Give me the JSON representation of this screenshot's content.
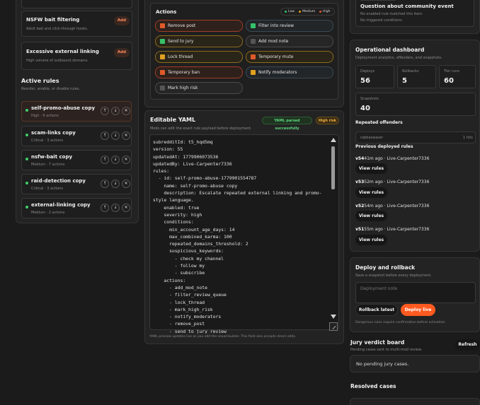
{
  "left_panel": {
    "bait_rule": {
      "title": "NSFW bait filtering",
      "desc": "Adult bait and click-through hooks.",
      "add": "Add"
    },
    "linking_rule": {
      "title": "Excessive external linking",
      "desc": "High volume of outbound domains.",
      "add": "Add"
    },
    "active_rules": {
      "title": "Active rules",
      "subtitle": "Reorder, enable, or disable rules.",
      "items": [
        {
          "name": "self-promo-abuse copy",
          "meta": "High · 9 actions"
        },
        {
          "name": "scam-links copy",
          "meta": "Critical · 3 actions"
        },
        {
          "name": "nsfw-bait copy",
          "meta": "Medium · 7 actions"
        },
        {
          "name": "raid-detection copy",
          "meta": "Critical · 3 actions"
        },
        {
          "name": "external-linking copy",
          "meta": "Medium · 2 actions"
        }
      ],
      "up": "↑",
      "down": "↓",
      "remove": "✕"
    }
  },
  "actions_panel": {
    "title": "Actions",
    "legend": {
      "low": "Low",
      "medium": "Medium",
      "high": "High"
    },
    "items": [
      "Remove post",
      "Filter into review",
      "Send to jury",
      "Add mod note",
      "Lock thread",
      "Temporary mute",
      "Temporary ban",
      "Notify moderators",
      "Mark high risk"
    ]
  },
  "yaml_panel": {
    "title": "Editable YAML",
    "subtitle": "Mods can edit the exact rule payload before deployment.",
    "status": "YAML parsed successfully",
    "risk": "High risk",
    "footer": "YAML preview updates live as you edit the visual builder. This field also accepts direct edits.",
    "code": "subredditId: t5_hqd5mq\nversion: 55\nupdatedAt: 1779906073536\nupdatedBy: Live-Carpenter7336\nrules:\n  - id: self-promo-abuse-1779901554787\n    name: self-promo-abuse copy\n    description: Escalate repeated external linking and promo-\nstyle language.\n    enabled: true\n    severity: high\n    conditions:\n      min_account_age_days: 14\n      max_combined_karma: 100\n      repeated_domains_threshold: 2\n      suspicious_keywords:\n        - check my channel\n        - follow my\n        - subscribe\n    actions:\n      - add_mod_note\n      - filter_review_queue\n      - lock_thread\n      - mark_high_risk\n      - notify_moderators\n      - remove_post\n      - send_to_jury_review"
  },
  "right_top": {
    "title": "Question about community event",
    "line1": "No enabled rule matched this item.",
    "line2": "No triggered conditions"
  },
  "ops": {
    "title": "Operational dashboard",
    "subtitle": "Deployment analytics, offenders, and snapshots.",
    "stats": [
      {
        "label": "Deploys",
        "value": "56"
      },
      {
        "label": "Rollbacks",
        "value": "5"
      },
      {
        "label": "Tier runs",
        "value": "60"
      }
    ],
    "snapshots": {
      "label": "Snapshots",
      "value": "40"
    },
    "offenders_title": "Repeated offenders",
    "offender": {
      "name": "rabbaswaser",
      "count": "1 hits"
    },
    "deployed_title": "Previous deployed rules",
    "deploys": [
      {
        "version": "v54",
        "when": "41m ago",
        "by": "Live-Carpenter7336"
      },
      {
        "version": "v53",
        "when": "52m ago",
        "by": "Live-Carpenter7336"
      },
      {
        "version": "v52",
        "when": "54m ago",
        "by": "Live-Carpenter7336"
      },
      {
        "version": "v51",
        "when": "55m ago",
        "by": "Live-Carpenter7336"
      }
    ],
    "view_label": "View rules"
  },
  "deploy": {
    "title": "Deploy and rollback",
    "subtitle": "Save a snapshot before every deployment.",
    "note_placeholder": "Deployment note",
    "rollback": "Rollback latest",
    "deploy": "Deploy live",
    "warning": "Dangerous rules require confirmation before activation."
  },
  "jury": {
    "title": "Jury verdict board",
    "subtitle": "Pending cases sent to multi-mod review.",
    "refresh": "Refresh",
    "empty": "No pending jury cases."
  },
  "resolved": {
    "title": "Resolved cases"
  },
  "colors": {
    "accent": "#ff5a1f",
    "low": "#36c26a",
    "medium": "#e0a020",
    "high": "#e05a2a"
  }
}
